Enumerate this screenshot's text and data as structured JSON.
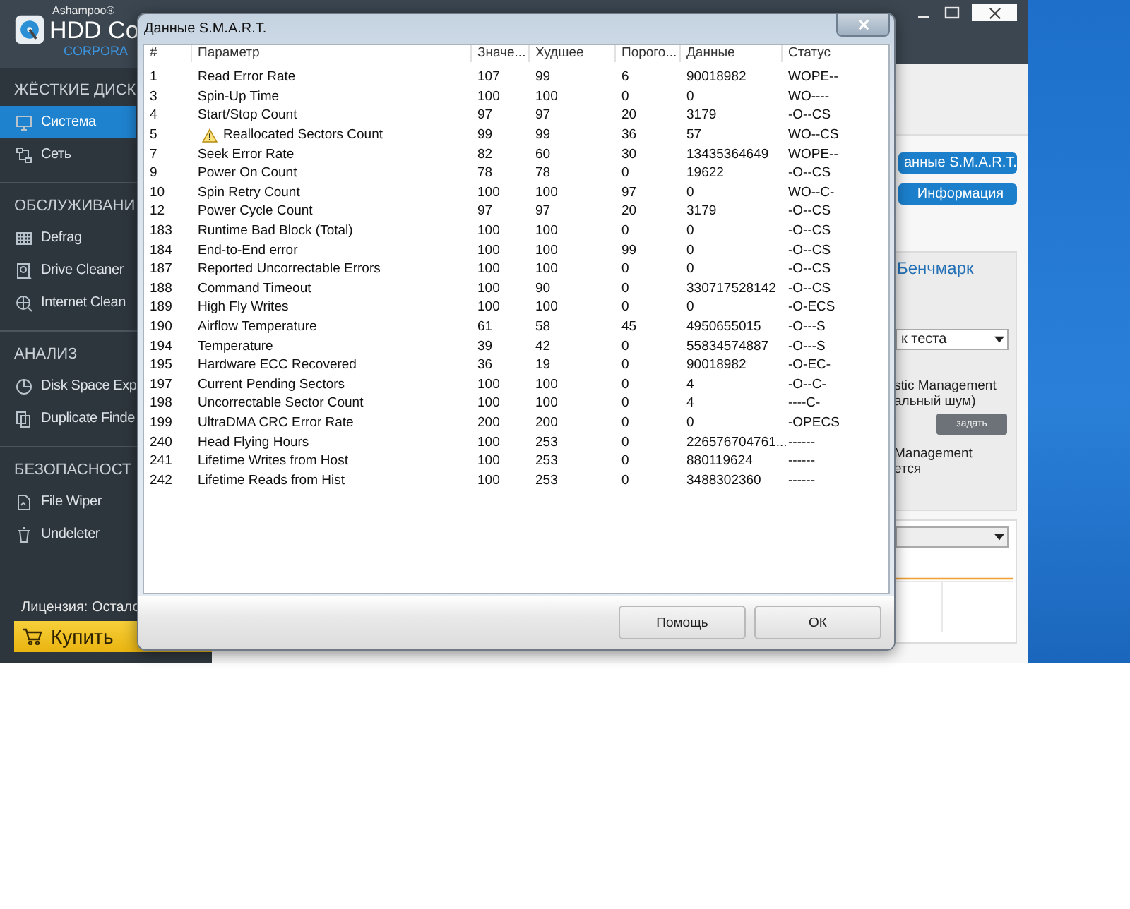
{
  "app": {
    "brand": "Ashampoo®",
    "product": "HDD Co",
    "edition": "CORPORA"
  },
  "sidebar": {
    "sections": [
      {
        "heading": "ЖЁСТКИЕ ДИСК",
        "items": [
          {
            "label": "Система",
            "selected": true
          },
          {
            "label": "Сеть",
            "selected": false
          }
        ]
      },
      {
        "heading": "ОБСЛУЖИВАНИ",
        "items": [
          {
            "label": "Defrag",
            "selected": false
          },
          {
            "label": "Drive Cleaner",
            "selected": false
          },
          {
            "label": "Internet Clean",
            "selected": false
          }
        ]
      },
      {
        "heading": "АНАЛИЗ",
        "items": [
          {
            "label": "Disk Space Exp",
            "selected": false
          },
          {
            "label": "Duplicate Finde",
            "selected": false
          }
        ]
      },
      {
        "heading": "БЕЗОПАСНОСТ",
        "items": [
          {
            "label": "File Wiper",
            "selected": false
          },
          {
            "label": "Undeleter",
            "selected": false
          }
        ]
      }
    ],
    "license": "Лицензия: Остало",
    "buy": "Купить"
  },
  "content": {
    "buttons": [
      "анные S.M.A.R.T.",
      "Информация"
    ],
    "benchmark": {
      "title": "Бенчмарк",
      "dropdown": "к теста",
      "lines": [
        "stic Management",
        "альный шум)"
      ],
      "button": "задать",
      "lines2": [
        "Management",
        "ется"
      ]
    }
  },
  "dialog": {
    "title": "Данные S.M.A.R.T.",
    "columns": [
      "#",
      "Параметр",
      "Значе...",
      "Худшее",
      "Порого...",
      "Данные",
      "Статус"
    ],
    "rows": [
      {
        "id": "1",
        "name": "Read Error Rate",
        "value": "107",
        "worst": "99",
        "threshold": "6",
        "data": "90018982",
        "status": "WOPE--",
        "warning": false
      },
      {
        "id": "3",
        "name": "Spin-Up Time",
        "value": "100",
        "worst": "100",
        "threshold": "0",
        "data": "0",
        "status": "WO----",
        "warning": false
      },
      {
        "id": "4",
        "name": "Start/Stop Count",
        "value": "97",
        "worst": "97",
        "threshold": "20",
        "data": "3179",
        "status": "-O--CS",
        "warning": false
      },
      {
        "id": "5",
        "name": "Reallocated Sectors Count",
        "value": "99",
        "worst": "99",
        "threshold": "36",
        "data": "57",
        "status": "WO--CS",
        "warning": true
      },
      {
        "id": "7",
        "name": "Seek Error Rate",
        "value": "82",
        "worst": "60",
        "threshold": "30",
        "data": "13435364649",
        "status": "WOPE--",
        "warning": false
      },
      {
        "id": "9",
        "name": "Power On Count",
        "value": "78",
        "worst": "78",
        "threshold": "0",
        "data": "19622",
        "status": "-O--CS",
        "warning": false
      },
      {
        "id": "10",
        "name": "Spin Retry Count",
        "value": "100",
        "worst": "100",
        "threshold": "97",
        "data": "0",
        "status": "WO--C-",
        "warning": false
      },
      {
        "id": "12",
        "name": "Power Cycle Count",
        "value": "97",
        "worst": "97",
        "threshold": "20",
        "data": "3179",
        "status": "-O--CS",
        "warning": false
      },
      {
        "id": "183",
        "name": "Runtime Bad Block (Total)",
        "value": "100",
        "worst": "100",
        "threshold": "0",
        "data": "0",
        "status": "-O--CS",
        "warning": false
      },
      {
        "id": "184",
        "name": "End-to-End error",
        "value": "100",
        "worst": "100",
        "threshold": "99",
        "data": "0",
        "status": "-O--CS",
        "warning": false
      },
      {
        "id": "187",
        "name": "Reported Uncorrectable Errors",
        "value": "100",
        "worst": "100",
        "threshold": "0",
        "data": "0",
        "status": "-O--CS",
        "warning": false
      },
      {
        "id": "188",
        "name": "Command Timeout",
        "value": "100",
        "worst": "90",
        "threshold": "0",
        "data": "330717528142",
        "status": "-O--CS",
        "warning": false
      },
      {
        "id": "189",
        "name": "High Fly Writes",
        "value": "100",
        "worst": "100",
        "threshold": "0",
        "data": "0",
        "status": "-O-ECS",
        "warning": false
      },
      {
        "id": "190",
        "name": "Airflow Temperature",
        "value": "61",
        "worst": "58",
        "threshold": "45",
        "data": "4950655015",
        "status": "-O---S",
        "warning": false
      },
      {
        "id": "194",
        "name": "Temperature",
        "value": "39",
        "worst": "42",
        "threshold": "0",
        "data": "55834574887",
        "status": "-O---S",
        "warning": false
      },
      {
        "id": "195",
        "name": "Hardware ECC Recovered",
        "value": "36",
        "worst": "19",
        "threshold": "0",
        "data": "90018982",
        "status": "-O-EC-",
        "warning": false
      },
      {
        "id": "197",
        "name": "Current Pending Sectors",
        "value": "100",
        "worst": "100",
        "threshold": "0",
        "data": "4",
        "status": "-O--C-",
        "warning": false
      },
      {
        "id": "198",
        "name": "Uncorrectable Sector Count",
        "value": "100",
        "worst": "100",
        "threshold": "0",
        "data": "4",
        "status": "----C-",
        "warning": false
      },
      {
        "id": "199",
        "name": "UltraDMA CRC Error Rate",
        "value": "200",
        "worst": "200",
        "threshold": "0",
        "data": "0",
        "status": "-OPECS",
        "warning": false
      },
      {
        "id": "240",
        "name": "Head Flying Hours",
        "value": "100",
        "worst": "253",
        "threshold": "0",
        "data": "226576704761...",
        "status": "------",
        "warning": false
      },
      {
        "id": "241",
        "name": "Lifetime Writes from Host",
        "value": "100",
        "worst": "253",
        "threshold": "0",
        "data": "880119624",
        "status": "------",
        "warning": false
      },
      {
        "id": "242",
        "name": "Lifetime Reads from Hist",
        "value": "100",
        "worst": "253",
        "threshold": "0",
        "data": "3488302360",
        "status": "------",
        "warning": false
      }
    ],
    "buttons": [
      "Помощь",
      "ОК"
    ]
  }
}
